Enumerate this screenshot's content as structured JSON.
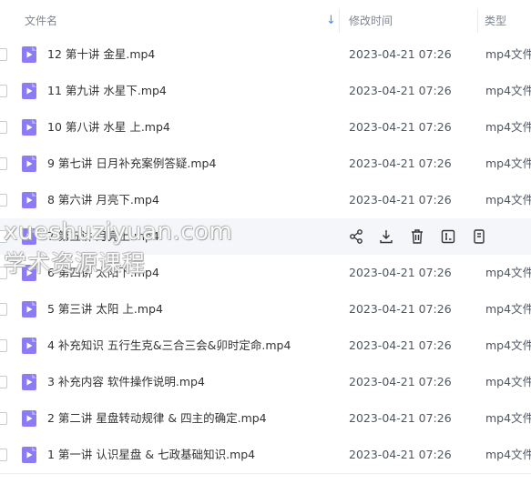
{
  "columns": {
    "name": "文件名",
    "modified": "修改时间",
    "type": "类型"
  },
  "files": [
    {
      "name": "12 第十讲  金星.mp4",
      "modified": "2023-04-21 07:26",
      "type": "mp4文件"
    },
    {
      "name": "11 第九讲 水星下.mp4",
      "modified": "2023-04-21 07:26",
      "type": "mp4文件"
    },
    {
      "name": "10 第八讲 水星 上.mp4",
      "modified": "2023-04-21 07:26",
      "type": "mp4文件"
    },
    {
      "name": "9 第七讲 日月补充案例答疑.mp4",
      "modified": "2023-04-21 07:26",
      "type": "mp4文件"
    },
    {
      "name": "8 第六讲 月亮下.mp4",
      "modified": "2023-04-21 07:26",
      "type": "mp4文件"
    },
    {
      "name": "7 第五讲 月亮上.mp4"
    },
    {
      "name": "6 第四讲 太阳下.mp4",
      "modified": "2023-04-21 07:26",
      "type": "mp4文件"
    },
    {
      "name": "5 第三讲 太阳 上.mp4",
      "modified": "2023-04-21 07:26",
      "type": "mp4文件"
    },
    {
      "name": "4 补充知识 五行生克&三合三会&卯时定命.mp4",
      "modified": "2023-04-21 07:26",
      "type": "mp4文件"
    },
    {
      "name": "3 补充内容 软件操作说明.mp4",
      "modified": "2023-04-21 07:26",
      "type": "mp4文件"
    },
    {
      "name": "2 第二讲 星盘转动规律 & 四主的确定.mp4",
      "modified": "2023-04-21 07:26",
      "type": "mp4文件"
    },
    {
      "name": "1 第一讲 认识星盘 & 七政基础知识.mp4",
      "modified": "2023-04-21 07:26",
      "type": "mp4文件"
    }
  ],
  "hover_row_index": 5,
  "hover_actions": [
    "share-icon",
    "download-icon",
    "delete-icon",
    "rename-icon",
    "more-icon"
  ],
  "sort_icon": "sort-down-arrow-icon",
  "file_icon": "video-file-icon",
  "watermark": {
    "line1": "xueshuziyuan.com",
    "line2": "学术资源课程"
  },
  "colors": {
    "accent": "#3f8cff",
    "file_icon": "#8b7cf6",
    "hover_bg": "#f5f6f9",
    "header_text": "#7e8591"
  }
}
